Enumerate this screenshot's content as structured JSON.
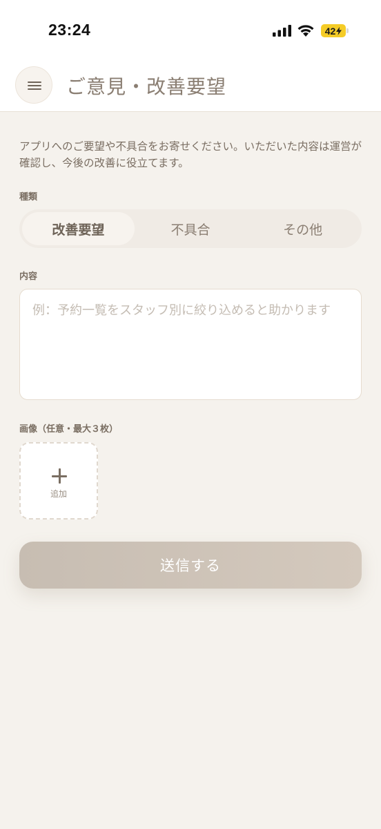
{
  "status_bar": {
    "time": "23:24",
    "battery": "42",
    "icons": [
      "signal-icon",
      "wifi-icon",
      "battery-charging-icon"
    ]
  },
  "header": {
    "title": "ご意見・改善要望",
    "menu_icon": "hamburger-menu-icon"
  },
  "intro_text": "アプリへのご要望や不具合をお寄せください。いただいた内容は運営が確認し、今後の改善に役立てます。",
  "type_section": {
    "label": "種類",
    "options": [
      "改善要望",
      "不具合",
      "その他"
    ],
    "selected": "改善要望"
  },
  "content_section": {
    "label": "内容",
    "value": "",
    "placeholder": "例：予約一覧をスタッフ別に絞り込めると助かります"
  },
  "image_section": {
    "label": "画像（任意・最大３枚）",
    "add_label": "追加",
    "add_icon": "plus-icon"
  },
  "submit": {
    "label": "送信する"
  },
  "colors": {
    "background": "#f5f2ed",
    "text": "#6e6358",
    "submit_button": "#cdc3b8"
  }
}
